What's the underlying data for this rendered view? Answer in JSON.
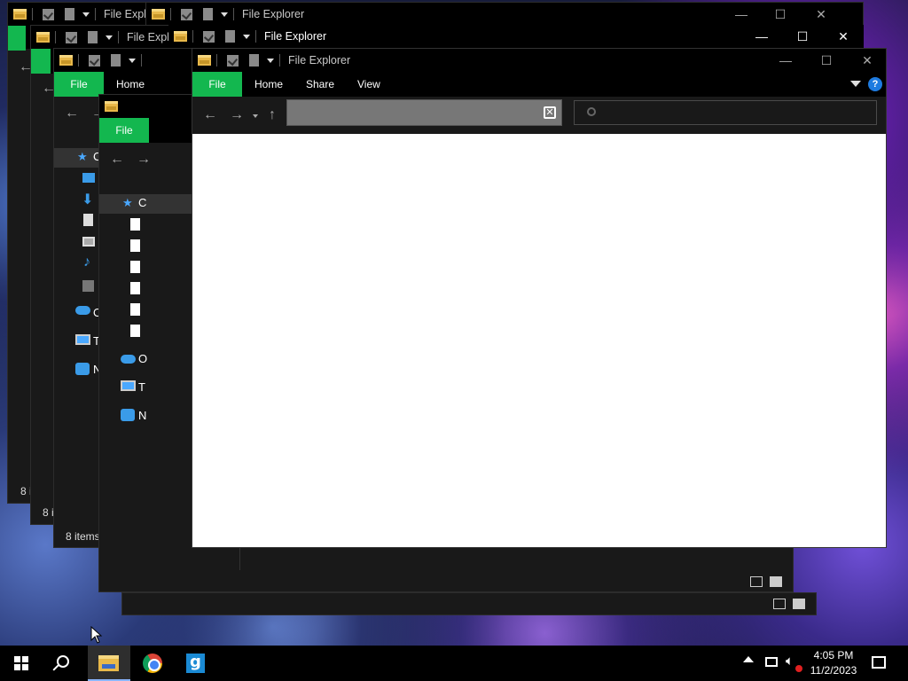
{
  "windows": {
    "title": "File Explorer",
    "title_truncated": "File Explo",
    "ribbon": {
      "file": "File",
      "home": "Home",
      "share": "Share",
      "view": "View"
    },
    "status_8_items": "8 items",
    "status_8_i": "8 i",
    "sidebar_truncated": {
      "c": "C",
      "o": "O",
      "t": "T",
      "n": "N"
    }
  },
  "caption": {
    "minimize": "—",
    "maximize": "☐",
    "close": "✕"
  },
  "taskbar": {
    "time": "4:05 PM",
    "date": "11/2/2023"
  },
  "colors": {
    "accent": "#13b74f",
    "window_bg": "#191919",
    "help": "#1e7be0"
  }
}
